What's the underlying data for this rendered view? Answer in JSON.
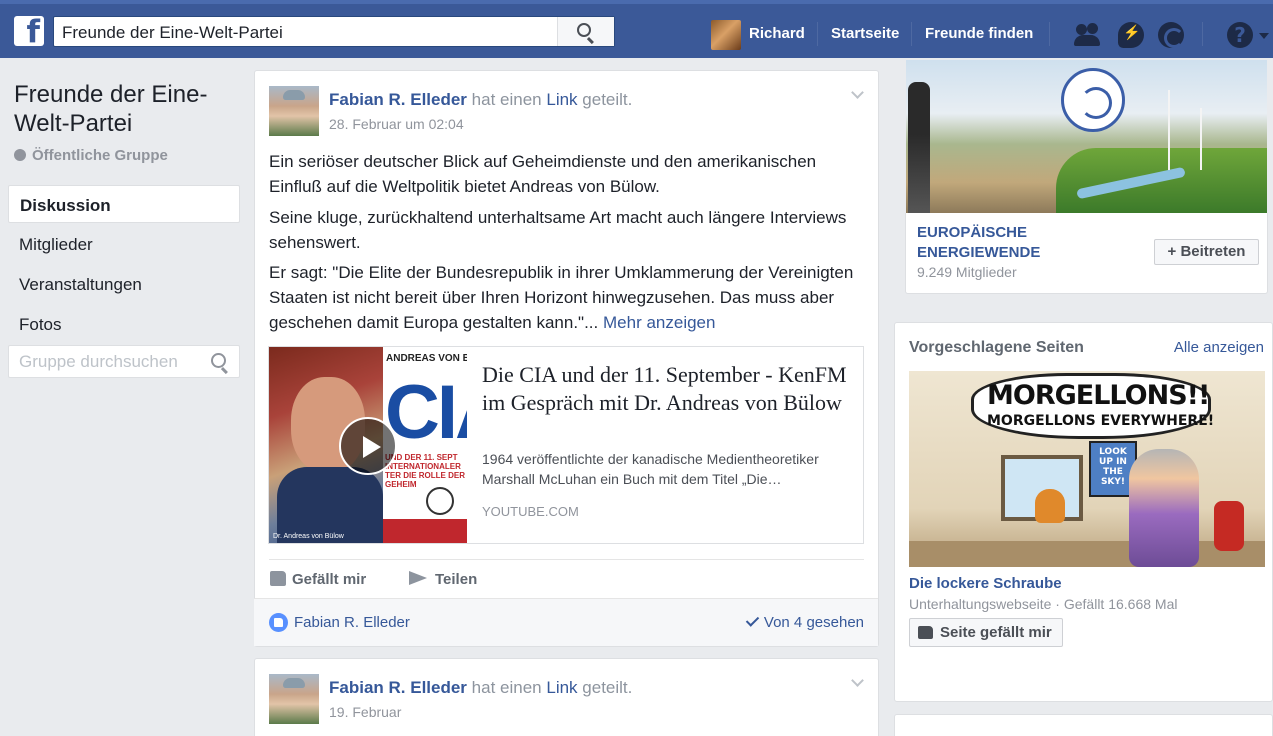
{
  "topbar": {
    "logo": "f",
    "search_value": "Freunde der Eine-Welt-Partei",
    "user": "Richard",
    "home": "Startseite",
    "find_friends": "Freunde finden",
    "help": "?",
    "icons": [
      "friend-requests-icon",
      "messenger-icon",
      "notifications-globe-icon",
      "help-icon"
    ]
  },
  "group": {
    "name": "Freunde der Eine-Welt-Partei",
    "type": "Öffentliche Gruppe",
    "nav": [
      "Diskussion",
      "Mitglieder",
      "Veranstaltungen",
      "Fotos"
    ],
    "search_placeholder": "Gruppe durchsuchen"
  },
  "post1": {
    "author": "Fabian R. Elleder",
    "action_pre": "hat einen",
    "action_link": "Link",
    "action_post": "geteilt.",
    "time": "28. Februar um 02:04",
    "p1": "Ein seriöser deutscher Blick auf Geheimdienste und den amerikanischen Einfluß auf die Weltpolitik bietet Andreas von Bülow.",
    "p2": "Seine kluge, zurückhaltend unterhaltsame Art macht auch längere Interviews sehenswert.",
    "p3": "Er sagt: \"Die Elite der Bundesrepublik in ihrer Umklammerung der Vereinigten Staaten ist nicht bereit über Ihren Horizont hinwegzusehen. Das muss aber geschehen damit Europa gestalten kann.\"...",
    "more": "Mehr anzeigen",
    "link": {
      "thumb_top": "ANDREAS VON B",
      "thumb_word": "CIA",
      "thumb_sub": "UND DER 11. SEPT INTERNATIONALER TER DIE ROLLE DER GEHEIM",
      "thumb_caption": "Dr. Andreas von Bülow",
      "title": "Die CIA und der 11. September - KenFM im Gespräch mit Dr. Andreas von Bülow",
      "description": "1964 veröffentlichte der kanadische Medientheoretiker Marshall McLuhan ein Buch mit dem Titel „Die…",
      "source": "YOUTUBE.COM"
    },
    "like_label": "Gefällt mir",
    "share_label": "Teilen",
    "liker": "Fabian R. Elleder",
    "seen": "Von 4 gesehen"
  },
  "post2": {
    "author": "Fabian R. Elleder",
    "action_pre": "hat einen",
    "action_link": "Link",
    "action_post": "geteilt.",
    "time": "19. Februar"
  },
  "sidebar": {
    "promo_group": {
      "name": "EUROPÄISCHE ENERGIEWENDE",
      "members": "9.249 Mitglieder",
      "join": "Beitreten"
    },
    "suggested": {
      "heading": "Vorgeschlagene Seiten",
      "see_all": "Alle anzeigen",
      "image_text_1": "MORGELLONS!!",
      "image_text_2": "MORGELLONS EVERYWHERE!",
      "image_sign": "LOOK UP IN THE SKY!",
      "page_name": "Die lockere Schraube",
      "page_meta": "Unterhaltungswebseite · Gefällt 16.668 Mal",
      "like_button": "Seite gefällt mir"
    }
  }
}
